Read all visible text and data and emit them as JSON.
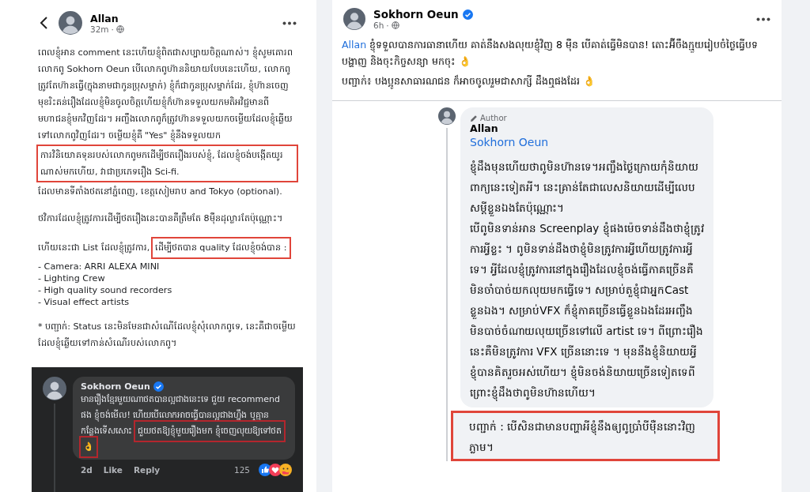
{
  "left_post": {
    "author": "Allan",
    "time": "32m",
    "meta_separator": "·",
    "blocks": [
      {
        "lines": [
          {
            "segments": [
              {
                "highlighted": false,
                "text": "ពេលខ្ញុំអាន comment នេះហើយខ្ញុំពិតជាសប្បាយចិត្តណាស់។ ខ្ញុំសូមគោរពលោកពូ Sokhorn Oeun បើលោកពូហ៊ាននិយាយបែបនេះហើយ, លោកពូត្រូវតែហ៊ានធ្វើ(ក្នុងនាមជាកូនប្រុសម្នាក់) ខ្ញុំក៏ជាកូនប្រុសម្នាក់ដែរ, ខ្ញុំហ៊ានចេញមុខរិះគន់រឿងដែលខ្ញុំមិនចូលចិត្តហើយខ្ញុំក៏ហ៊ានទទួលយកមតិអវិជ្ជមានពីមហាជនខ្ញុំមកវិញដែរ។ អញ្ចឹងលោកពូក៏ត្រូវហ៊ានទទួលយកចម្លើយដែលខ្ញុំឆ្លើយទៅលោកពូវិញដែរ។ ចម្លើយខ្ញុំគឺ \"Yes\" ខ្ញុំនឹងទទួលយក"
              }
            ]
          },
          {
            "segments": [
              {
                "highlighted": true,
                "text": "ការវិនិយោគទុនរបស់លោកពូមកដើម្បីថតរឿងរបស់ខ្ញុំ, ដែលខ្ញុំចង់បង្កើតយូរណាស់មកហើយ, វាជាប្រភេទរឿង Sci-fi."
              }
            ]
          },
          {
            "segments": [
              {
                "highlighted": false,
                "text": "ដែលមានទីតាំងថតនៅភ្នំពេញ, ខេត្តសៀមរាប and Tokyo (optional)."
              }
            ]
          }
        ]
      },
      {
        "lines": [
          {
            "segments": [
              {
                "highlighted": false,
                "text": "ថវិការដែលខ្ញុំត្រូវការដើម្បីថតរឿងនេះបានគឺត្រឹមតែ 8ម៉ឺនដុល្លារតែប៉ុណ្ណោះ។"
              }
            ]
          }
        ]
      },
      {
        "lines": [
          {
            "segments": [
              {
                "highlighted": false,
                "text": "ហើយនេះជា List ដែលខ្ញុំត្រូវការ, "
              },
              {
                "highlighted": true,
                "text": "ដើម្បីថតបាន quality ដែលខ្ញុំចង់បាន :"
              }
            ]
          },
          {
            "segments": [
              {
                "highlighted": false,
                "text": "- Camera: ARRI ALEXA MINI"
              }
            ]
          },
          {
            "segments": [
              {
                "highlighted": false,
                "text": "- Lighting Crew"
              }
            ]
          },
          {
            "segments": [
              {
                "highlighted": false,
                "text": "- High quality sound recorders"
              }
            ]
          },
          {
            "segments": [
              {
                "highlighted": false,
                "text": "- Visual effect artists"
              }
            ]
          }
        ]
      },
      {
        "lines": [
          {
            "segments": [
              {
                "highlighted": false,
                "text": "* បញ្ជាក់: Status នេះមិនមែនជាសំណើដែលខ្ញុំសុំលោកពូទេ, នេះគឺជាចម្លើយដែលខ្ញុំឆ្លើយទៅកាន់សំណើរបស់លោកពូ។"
              }
            ]
          }
        ]
      }
    ]
  },
  "left_comment": {
    "author": "Sokhorn Oeun",
    "verified": true,
    "segments": [
      {
        "highlighted": false,
        "text": "មានរឿងខ្មែរមួយណាថតបានល្អជាងនេះទេ ជួយ recommend ផង ខ្ញុំចង់មើល! ហើយបើលោកអាចធ្វើបានល្អជាងហ្នឹង ឬគ្មានកន្លែងទើសសោះ "
      },
      {
        "highlighted": true,
        "text": "ជួយថតឱ្យខ្ញុំមួយរឿងមក ខ្ញុំចេញលុយឱ្យទៅថត 👌"
      }
    ],
    "time": "2d",
    "actions": [
      "Like",
      "Reply"
    ],
    "reaction_count": "125"
  },
  "right_post": {
    "author": "Sokhorn Oeun",
    "verified": true,
    "time": "6h",
    "meta_separator": "·",
    "lines": [
      {
        "segments": [
          {
            "kind": "mention",
            "highlighted": false,
            "text": "Allan"
          },
          {
            "highlighted": false,
            "text": " ខ្ញុំទទួលបានការធានាហើយ គាត់នឹងសងលុយខ្ញុំវិញ 8 ម៉ឺន បើគាត់ធ្វើមិនបាន! តោះអ៊ីចឹងក្មួយរៀបចំថ្ងៃធ្វើបទបង្ហាញ និងចុះកិច្ចសន្យា មកចុះ 👌"
          }
        ]
      },
      {
        "segments": [
          {
            "highlighted": false,
            "text": "បញ្ជាក់៖ បងប្អូនសាធារណជន ក៏អាចចូលរួមជាសាក្សី ដឹងឮផងដែរ 👌"
          }
        ]
      }
    ]
  },
  "reply": {
    "badge": "Author",
    "author": "Allan",
    "mention": "Sokhorn Oeun",
    "lines": [
      {
        "segments": [
          {
            "highlighted": false,
            "text": "ខ្ញុំដឹងមុនហើយថាពូមិនហ៊ានទេ។អញ្ចឹងថ្ងៃក្រោយកុំនិយាយពាក្យនេះទៀតអី។ នេះគ្រាន់តែជាលេសនិយាយដើម្បីលេបសម្ដីខ្លួនឯងតែប៉ុណ្ណោះ។"
          }
        ]
      },
      {
        "segments": [
          {
            "highlighted": false,
            "text": "បើពូមិនទាន់អាន Screenplay ខ្ញុំផងម៉េចទាន់ដឹងថាខ្ញុំត្រូវការអ្វីខ្លះ ។ ពូមិនទាន់ដឹងថាខ្ញុំមិនត្រូវការអ្វីហើយត្រូវការអ្វីទេ។ អ្វីដែលខ្ញុំត្រូវការនៅក្នុងរឿងដែលខ្ញុំចង់ធ្វើភាគច្រើនគឺមិនចាំបាច់យកលុយមកធ្វើទេ។ សម្រាប់តួខ្ញុំជាអ្នកCast ខ្លួនឯង។ សម្រាប់VFX ក៏ខ្ញុំភាគច្រើនធ្វើខ្លួនឯងដែរអញ្ចឹងមិនបាច់ចំណាយលុយច្រើនទៅលើ artist ទេ។ ពីព្រោះរឿងនេះគឺមិនត្រូវការ VFX ច្រើននោះទេ ។ មុននឹងខ្ញុំនិយាយអ្វីខ្ញុំបានគិតរួចអស់ហើយ។ ខ្ញុំមិនចង់និយាយច្រើនទៀតទេពីព្រោះខ្ញុំដឹងថាពូមិនហ៊ានហើយ។"
          }
        ]
      }
    ],
    "note": {
      "highlighted": true,
      "text": "បញ្ជាក់ : បើសិនជាមានបញ្ហាអីខ្ញុំនឹងឲ្យពូប្រាំបីម៉ឺននោះវិញភ្លាម។"
    }
  }
}
